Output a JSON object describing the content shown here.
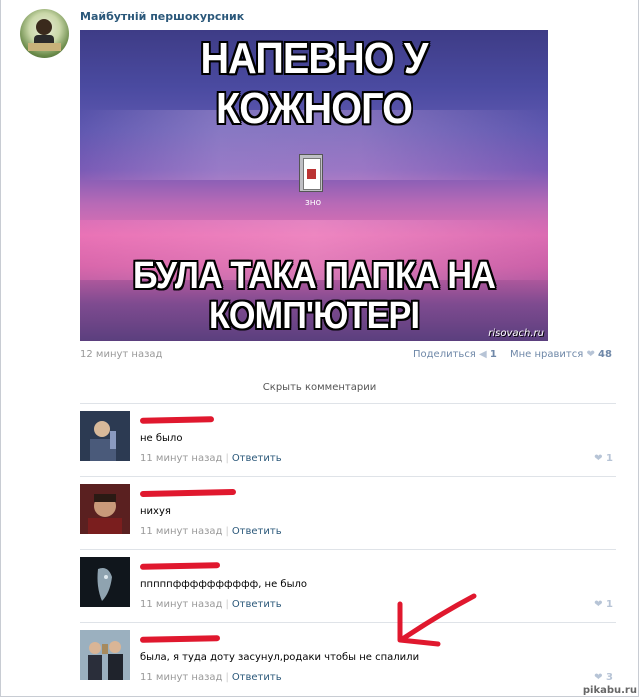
{
  "post": {
    "author": "Майбутній першокурсник",
    "meme_top": "НАПЕВНО У КОЖНОГО",
    "meme_bottom_1": "БУЛА ТАКА ПАПКА НА",
    "meme_bottom_2": "КОМП'ЮТЕРІ",
    "folder_label": "зно",
    "watermark": "risovach.ru",
    "time": "12 минут назад",
    "share_label": "Поделиться",
    "share_count": "1",
    "like_label": "Мне нравится",
    "like_count": "48",
    "hide_comments": "Скрыть комментарии"
  },
  "comments": [
    {
      "text": "не было",
      "time": "11 минут назад",
      "reply": "Ответить",
      "likes": "1"
    },
    {
      "text": "нихуя",
      "time": "11 минут назад",
      "reply": "Ответить",
      "likes": ""
    },
    {
      "text": "пппппфффффффффф, не было",
      "time": "11 минут назад",
      "reply": "Ответить",
      "likes": "1"
    },
    {
      "text": "была, я туда доту засунул,родаки чтобы не спалили",
      "time": "11 минут назад",
      "reply": "Ответить",
      "likes": "3"
    }
  ],
  "site_watermark": "pikabu.ru",
  "colors": {
    "link": "#2b587a",
    "redact": "#e0182e",
    "arrow": "#e0182e"
  }
}
